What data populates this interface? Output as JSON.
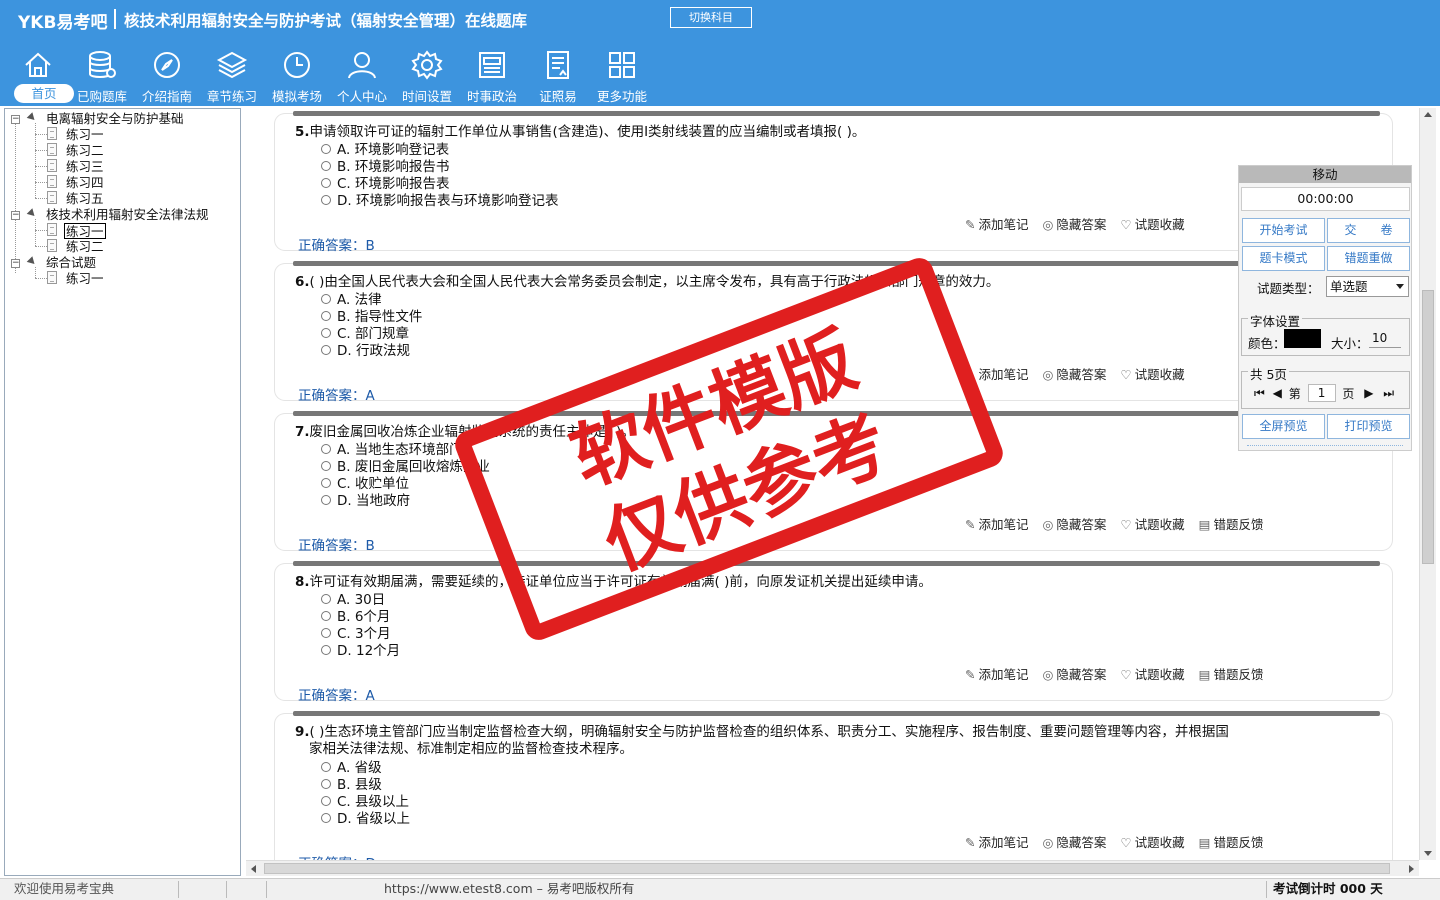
{
  "header": {
    "logo": "YKB易考吧",
    "title": "核技术利用辐射安全与防护考试（辐射安全管理）在线题库",
    "switch_subject": "切换科目"
  },
  "nav": [
    {
      "label": "首页",
      "icon": "home-icon"
    },
    {
      "label": "已购题库",
      "icon": "database-icon"
    },
    {
      "label": "介绍指南",
      "icon": "compass-icon"
    },
    {
      "label": "章节练习",
      "icon": "layers-icon"
    },
    {
      "label": "模拟考场",
      "icon": "clock-icon"
    },
    {
      "label": "个人中心",
      "icon": "user-icon"
    },
    {
      "label": "时间设置",
      "icon": "gear-icon"
    },
    {
      "label": "时事政治",
      "icon": "newspaper-icon"
    },
    {
      "label": "证照易",
      "icon": "certificate-icon"
    },
    {
      "label": "更多功能",
      "icon": "grid-icon"
    }
  ],
  "tree": {
    "groups": [
      {
        "label": "电离辐射安全与防护基础",
        "items": [
          "练习一",
          "练习二",
          "练习三",
          "练习四",
          "练习五"
        ]
      },
      {
        "label": "核技术利用辐射安全法律法规",
        "items": [
          "练习一",
          "练习二"
        ]
      },
      {
        "label": "综合试题",
        "items": [
          "练习一"
        ]
      }
    ]
  },
  "questions": [
    {
      "num": "5.",
      "text": "申请领取许可证的辐射工作单位从事销售(含建造)、使用Ⅰ类射线装置的应当编制或者填报(  )。",
      "text2": "",
      "options": [
        "A. 环境影响登记表",
        "B. 环境影响报告书",
        "C. 环境影响报告表",
        "D. 环境影响报告表与环境影响登记表"
      ],
      "answer": "B"
    },
    {
      "num": "6.",
      "text": "(  )由全国人民代表大会和全国人民代表大会常务委员会制定，以主席令发布，具有高于行政法规和部门规章的效力。",
      "text2": "",
      "options": [
        "A. 法律",
        "B. 指导性文件",
        "C. 部门规章",
        "D. 行政法规"
      ],
      "answer": "A"
    },
    {
      "num": "7.",
      "text": "废旧金属回收冶炼企业辐射监测系统的责任主体是(  )。",
      "text2": "",
      "options": [
        "A. 当地生态环境部门",
        "B. 废旧金属回收熔炼企业",
        "C. 收贮单位",
        "D. 当地政府"
      ],
      "answer": "B"
    },
    {
      "num": "8.",
      "text": "许可证有效期届满，需要延续的，持证单位应当于许可证有效期届满(  )前，向原发证机关提出延续申请。",
      "text2": "",
      "options": [
        "A. 30日",
        "B. 6个月",
        "C. 3个月",
        "D. 12个月"
      ],
      "answer": "A"
    },
    {
      "num": "9.",
      "text": "(  )生态环境主管部门应当制定监督检查大纲，明确辐射安全与防护监督检查的组织体系、职责分工、实施程序、报告制度、重要问题管理等内容，并根据国",
      "text2": "家相关法律法规、标准制定相应的监督检查技术程序。",
      "options": [
        "A. 省级",
        "B. 县级",
        "C. 县级以上",
        "D. 省级以上"
      ],
      "answer": "D"
    }
  ],
  "question_labels": {
    "answer_prefix": "正确答案：",
    "add_note": "添加笔记",
    "hide_answer": "隐藏答案",
    "favorite": "试题收藏",
    "feedback": "错题反馈"
  },
  "float_panel": {
    "move": "移动",
    "timer": "00:00:00",
    "start_exam": "开始考试",
    "submit": "交　　卷",
    "card_mode": "题卡模式",
    "redo_wrong": "错题重做",
    "type_label": "试题类型：",
    "type_value": "单选题",
    "font_legend": "字体设置",
    "color_label": "颜色：",
    "size_label": "大小：",
    "size_value": "10",
    "pages_legend": "共 5页",
    "page_prefix": "第",
    "page_value": "1",
    "page_suffix": "页",
    "fullscreen_preview": "全屏预览",
    "print_preview": "打印预览",
    "font_color": "#000000"
  },
  "watermark": {
    "line1": "软件模版",
    "line2": "仅供参考"
  },
  "status": {
    "welcome": "欢迎使用易考宝典",
    "copyright": "https://www.etest8.com – 易考吧版权所有",
    "countdown": "考试倒计时 000 天"
  },
  "colors": {
    "header_bg": "#3d94de",
    "answer_blue": "#1d5aa8",
    "stamp_red": "#e01f1f"
  }
}
